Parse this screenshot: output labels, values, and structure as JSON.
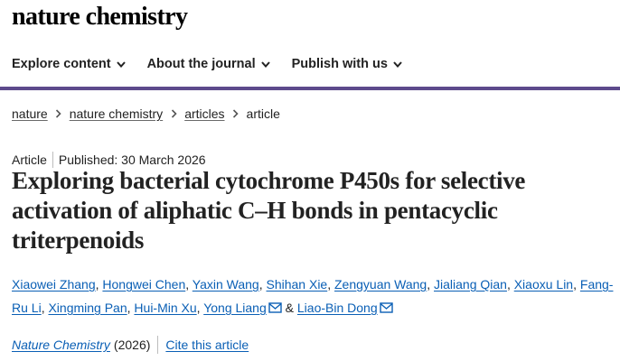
{
  "brand": {
    "name": "nature chemistry"
  },
  "nav": {
    "items": [
      {
        "label": "Explore content"
      },
      {
        "label": "About the journal"
      },
      {
        "label": "Publish with us"
      }
    ]
  },
  "breadcrumb": {
    "items": [
      {
        "label": "nature"
      },
      {
        "label": "nature chemistry"
      },
      {
        "label": "articles"
      },
      {
        "label": "article"
      }
    ]
  },
  "article": {
    "type": "Article",
    "published": "Published: 30 March 2026",
    "title": "Exploring bacterial cytochrome P450s for selective activation of aliphatic C–H bonds in pentacyclic triterpenoids",
    "authors": [
      {
        "name": "Xiaowei Zhang",
        "sep": ", "
      },
      {
        "name": "Hongwei Chen",
        "sep": ", "
      },
      {
        "name": "Yaxin Wang",
        "sep": ", "
      },
      {
        "name": "Shihan Xie",
        "sep": ", "
      },
      {
        "name": "Zengyuan Wang",
        "sep": ", "
      },
      {
        "name": "Jialiang Qian",
        "sep": ", "
      },
      {
        "name": "Xiaoxu Lin",
        "sep": ", "
      },
      {
        "name": "Fang-Ru Li",
        "sep": ", "
      },
      {
        "name": "Xingming Pan",
        "sep": ", "
      },
      {
        "name": "Hui-Min Xu",
        "sep": ", "
      },
      {
        "name": "Yong Liang",
        "sep": " & "
      },
      {
        "name": "Liao-Bin Dong",
        "sep": ""
      }
    ],
    "journal": "Nature Chemistry",
    "year": "(2026)",
    "cite_label": "Cite this article"
  },
  "icons": {
    "chevron": "chevron-down-icon",
    "breadcrumb_sep": "chevron-right-icon",
    "mail": "mail-icon"
  },
  "colors": {
    "accent_bar": "#5d4a8c",
    "link": "#0a5fb5",
    "text": "#222222"
  }
}
